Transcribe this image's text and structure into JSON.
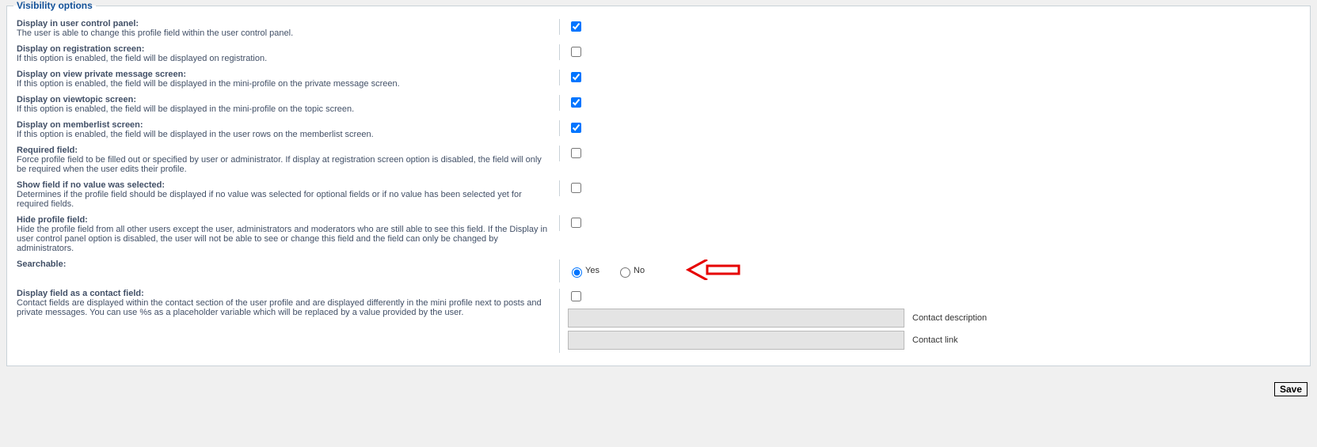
{
  "section": {
    "legend": "Visibility options"
  },
  "fields": {
    "ucp": {
      "label": "Display in user control panel:",
      "desc": "The user is able to change this profile field within the user control panel."
    },
    "reg": {
      "label": "Display on registration screen:",
      "desc": "If this option is enabled, the field will be displayed on registration."
    },
    "pm": {
      "label": "Display on view private message screen:",
      "desc": "If this option is enabled, the field will be displayed in the mini-profile on the private message screen."
    },
    "vt": {
      "label": "Display on viewtopic screen:",
      "desc": "If this option is enabled, the field will be displayed in the mini-profile on the topic screen."
    },
    "ml": {
      "label": "Display on memberlist screen:",
      "desc": "If this option is enabled, the field will be displayed in the user rows on the memberlist screen."
    },
    "req": {
      "label": "Required field:",
      "desc": "Force profile field to be filled out or specified by user or administrator. If display at registration screen option is disabled, the field will only be required when the user edits their profile."
    },
    "novalue": {
      "label": "Show field if no value was selected:",
      "desc": "Determines if the profile field should be displayed if no value was selected for optional fields or if no value has been selected yet for required fields."
    },
    "hide": {
      "label": "Hide profile field:",
      "desc": "Hide the profile field from all other users except the user, administrators and moderators who are still able to see this field. If the Display in user control panel option is disabled, the user will not be able to see or change this field and the field can only be changed by administrators."
    },
    "search": {
      "label": "Searchable:",
      "yes": "Yes",
      "no": "No"
    },
    "contact": {
      "label": "Display field as a contact field:",
      "desc": "Contact fields are displayed within the contact section of the user profile and are displayed differently in the mini profile next to posts and private messages. You can use %s as a placeholder variable which will be replaced by a value provided by the user.",
      "desc_caption": "Contact description",
      "link_caption": "Contact link"
    }
  },
  "values": {
    "ucp": true,
    "reg": false,
    "pm": true,
    "vt": true,
    "ml": true,
    "req": false,
    "novalue": false,
    "hide": false,
    "search": "yes",
    "contact_enabled": false,
    "contact_desc": "",
    "contact_link": ""
  },
  "buttons": {
    "save": "Save"
  }
}
